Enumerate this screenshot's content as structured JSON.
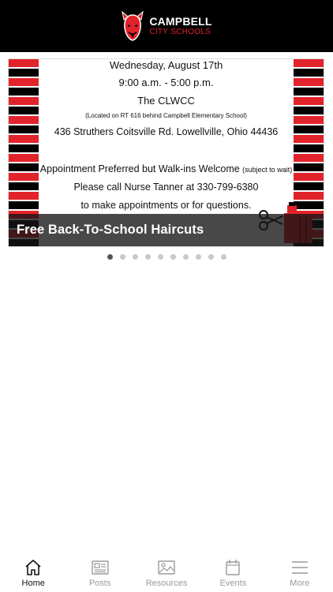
{
  "header": {
    "logo_line1": "CAMPBELL",
    "logo_line2": "CITY SCHOOLS"
  },
  "carousel": {
    "slide": {
      "flyer_lines": [
        "Wednesday, August 17th",
        "9:00 a.m. - 5:00 p.m.",
        "The CLWCC",
        "(Located on RT 616 behind Campbell Elementary School)",
        "436 Struthers Coitsville Rd. Lowellville, Ohio 44436",
        "Appointment Preferred but Walk-ins Welcome",
        "(subject to wait)",
        "Please call Nurse Tanner at 330-799-6380",
        "to make appointments or for questions."
      ],
      "caption": "Free Back-To-School Haircuts"
    },
    "dot_count": 10,
    "active_index": 0
  },
  "tabbar": {
    "tabs": [
      {
        "label": "Home",
        "icon": "home-icon",
        "active": true
      },
      {
        "label": "Posts",
        "icon": "posts-icon",
        "active": false
      },
      {
        "label": "Resources",
        "icon": "resources-icon",
        "active": false
      },
      {
        "label": "Events",
        "icon": "events-icon",
        "active": false
      },
      {
        "label": "More",
        "icon": "menu-icon",
        "active": false
      }
    ]
  },
  "colors": {
    "brand_red": "#e3232b",
    "header_bg": "#000000",
    "tab_inactive": "#9a9a9a",
    "tab_active": "#111111"
  }
}
